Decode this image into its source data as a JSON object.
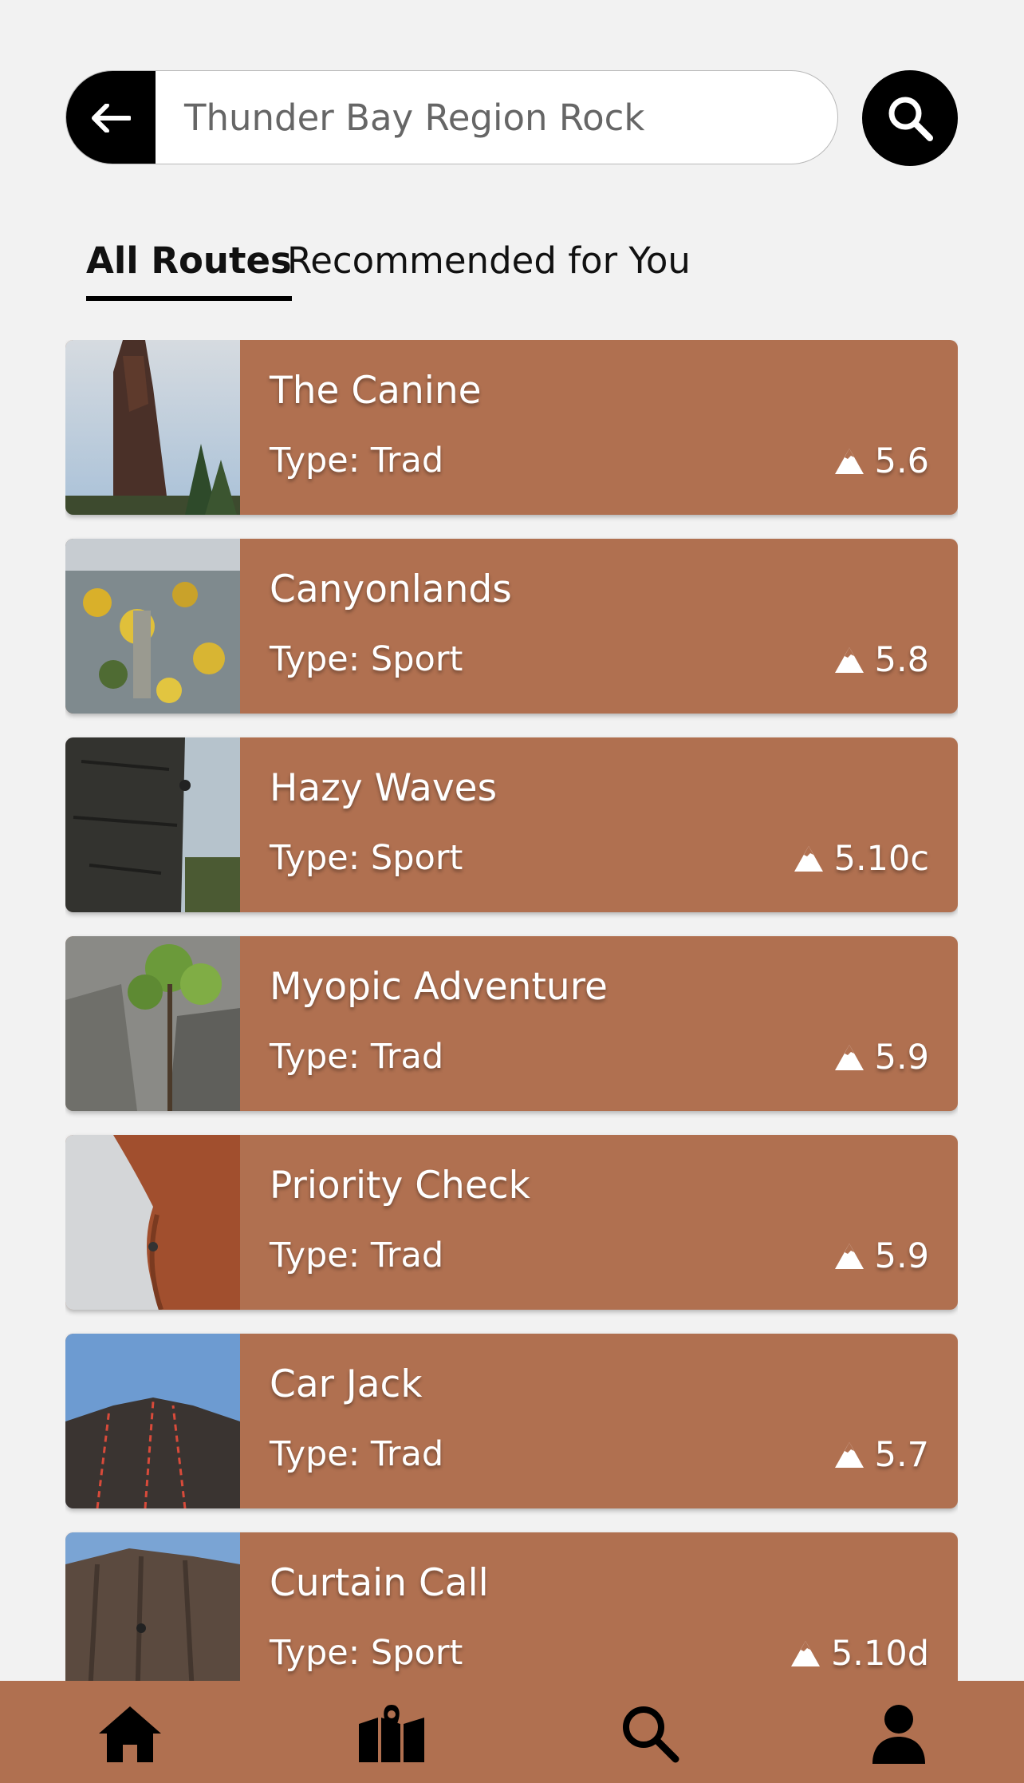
{
  "search": {
    "value": "Thunder Bay Region Rock"
  },
  "tabs": [
    {
      "label": "All Routes",
      "active": true
    },
    {
      "label": "Recommended for You",
      "active": false
    }
  ],
  "routes": [
    {
      "name": "The Canine",
      "type": "Type: Trad",
      "grade": "5.6"
    },
    {
      "name": "Canyonlands",
      "type": "Type: Sport",
      "grade": "5.8"
    },
    {
      "name": "Hazy Waves",
      "type": "Type: Sport",
      "grade": "5.10c"
    },
    {
      "name": "Myopic Adventure",
      "type": "Type: Trad",
      "grade": "5.9"
    },
    {
      "name": "Priority Check",
      "type": "Type: Trad",
      "grade": "5.9"
    },
    {
      "name": "Car Jack",
      "type": "Type: Trad",
      "grade": "5.7"
    },
    {
      "name": "Curtain Call",
      "type": "Type: Sport",
      "grade": "5.10d"
    }
  ],
  "nav": {
    "items": [
      "home-icon",
      "map-icon",
      "search-icon",
      "profile-icon"
    ]
  },
  "colors": {
    "card": "#b07050",
    "background": "#f2f2f2",
    "accent": "#000000"
  }
}
